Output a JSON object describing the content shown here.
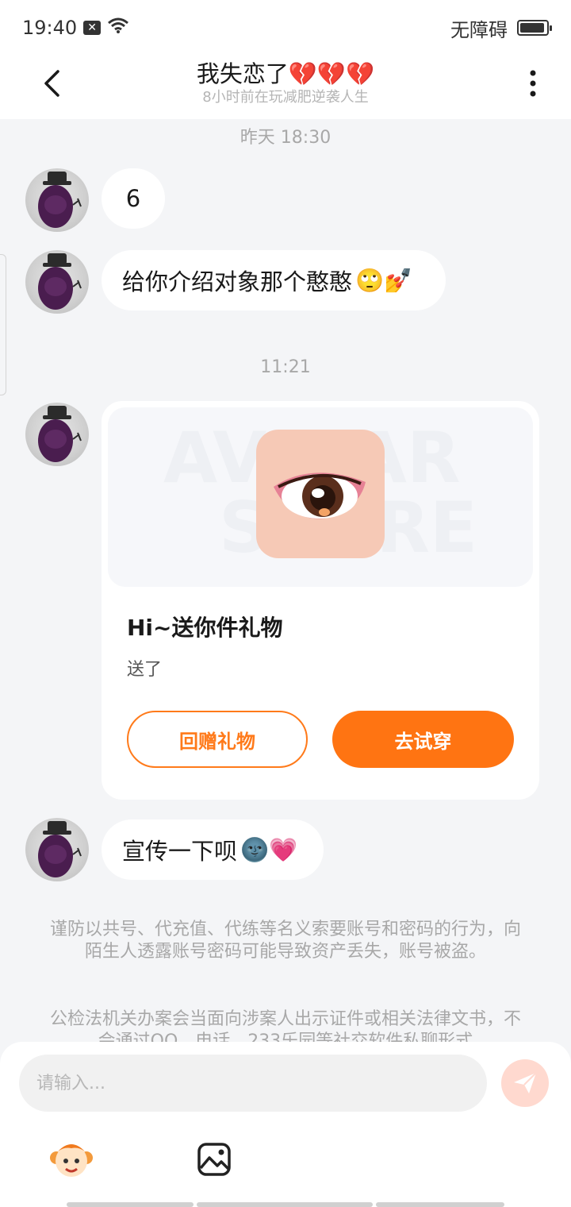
{
  "status_bar": {
    "time": "19:40",
    "accessibility": "无障碍",
    "battery_level": 0.95,
    "icons": [
      "notification-x-icon",
      "wifi-icon",
      "battery-icon"
    ]
  },
  "header": {
    "title": "我失恋了💔💔💔",
    "subtitle": "8小时前在玩减肥逆袭人生"
  },
  "messages": {
    "time_1": "昨天 18:30",
    "msg_1": "6",
    "msg_2_text": "给你介绍对象那个憨憨",
    "msg_2_emoji": "🙄💅",
    "time_2": "11:21",
    "gift": {
      "watermark_top": "AVATAR",
      "watermark_bottom": "STORE",
      "title": "Hi~送你件礼物",
      "desc": "送了",
      "return_gift_label": "回赠礼物",
      "try_on_label": "去试穿"
    },
    "msg_4_text": "宣传一下呗",
    "msg_4_emoji": "🌚💗"
  },
  "notice": {
    "p1": "谨防以共号、代充值、代练等名义索要账号和密码的行为，向陌生人透露账号密码可能导致资产丢失，账号被盗。",
    "p2": "公检法机关办案会当面向涉案人出示证件或相关法律文书，不会通过QQ、电话、233乐园等社交软件私聊形式"
  },
  "input": {
    "placeholder": "请输入...",
    "value": ""
  },
  "colors": {
    "accent": "#ff7412",
    "send_button_disabled": "#ffd9cf",
    "background": "#f4f5f7"
  }
}
